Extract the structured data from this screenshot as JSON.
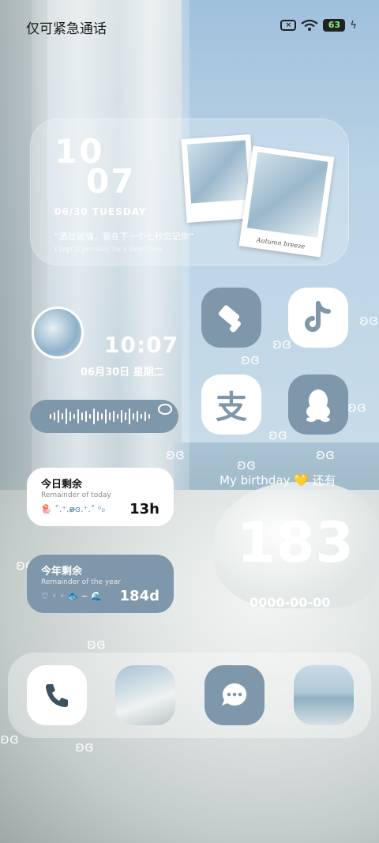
{
  "status_bar": {
    "carrier": "仅可紧急通话",
    "sim_icon": "sim-off-icon",
    "wifi_icon": "wifi-icon",
    "battery_level": "63",
    "charging_icon": "charging-bolt-icon"
  },
  "clock_widget": {
    "hour": "10",
    "minute": "07",
    "date": "06/30  TUESDAY",
    "quote": "“透过玻璃，我在下一个七秒忘记你”",
    "quote_en": "I kept it privately for a short time",
    "photo_caption": "Autumn breeze"
  },
  "avatar_clock": {
    "time": "10:07",
    "date": "06月30日    星期二"
  },
  "apps": [
    {
      "name": "paintbrush-app-icon"
    },
    {
      "name": "tiktok-app-icon"
    },
    {
      "name": "alipay-app-icon"
    },
    {
      "name": "qq-app-icon"
    }
  ],
  "remaining_today": {
    "title": "今日剩余",
    "subtitle": "Remainder of today",
    "decoration": "🪼 ˚.⁺.ʚ̴̶̷̷ɞ.⁺.˚ ᵒ₀",
    "value": "13h"
  },
  "remaining_year": {
    "title": "今年剩余",
    "subtitle": "Remainder of the year",
    "decoration": "♡ ◦ ◦ 🐟 ~ 🌊",
    "value": "184d"
  },
  "birthday": {
    "label": "My birthday  💛  还有",
    "days": "183",
    "date": "0000-00-00"
  },
  "dock": [
    {
      "name": "phone-app-icon"
    },
    {
      "name": "photo-widget-1"
    },
    {
      "name": "messages-app-icon"
    },
    {
      "name": "photo-widget-2"
    }
  ],
  "colors": {
    "accent": "#7f97aa",
    "card_white": "#ffffff"
  }
}
